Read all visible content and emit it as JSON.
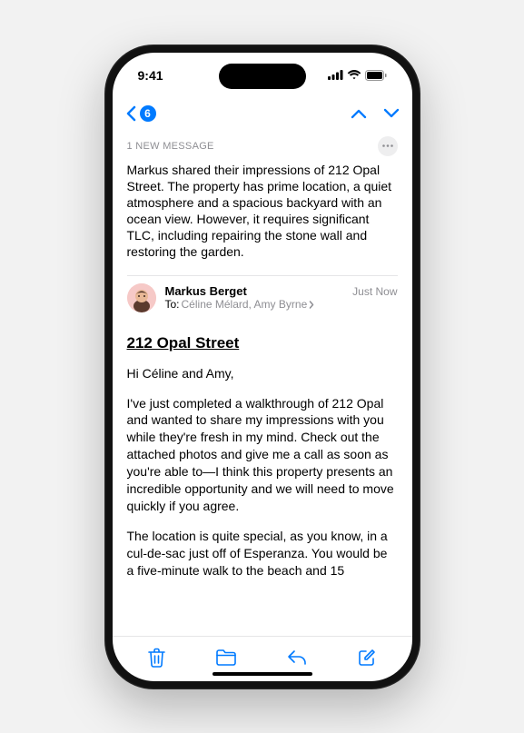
{
  "status": {
    "time": "9:41"
  },
  "nav": {
    "back_badge": "6"
  },
  "preview": {
    "label": "1 NEW MESSAGE",
    "summary": "Markus shared their impressions of 212 Opal Street. The property has prime location, a quiet atmosphere and a spacious backyard with an ocean view. However, it requires significant TLC, including repairing the stone wall and restoring the garden."
  },
  "email": {
    "sender": "Markus Berget",
    "to_label": "To:",
    "recipients": "Céline Mélard, Amy Byrne",
    "timestamp": "Just Now",
    "subject": "212 Opal Street",
    "greeting": "Hi Céline and Amy,",
    "para1": "I've just completed a walkthrough of 212 Opal and wanted to share my impressions with you while they're fresh in my mind. Check out the attached photos and give me a call as soon as you're able to—I think this property presents an incredible opportunity and we will need to move quickly if you agree.",
    "para2": "The location is quite special, as you know, in a cul-de-sac just off of Esperanza. You would be a five-minute walk to the beach and 15"
  }
}
